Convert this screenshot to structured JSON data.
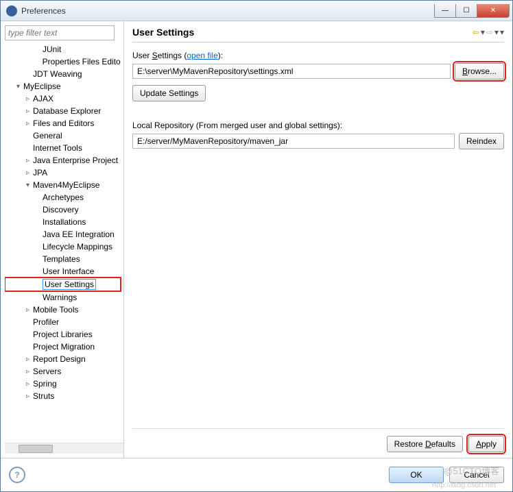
{
  "window": {
    "title": "Preferences"
  },
  "filter": {
    "placeholder": "type filter text"
  },
  "tree": {
    "items": [
      {
        "indent": 3,
        "label": "JUnit",
        "twisty": ""
      },
      {
        "indent": 3,
        "label": "Properties Files Editor",
        "twisty": ""
      },
      {
        "indent": 2,
        "label": "JDT Weaving",
        "twisty": ""
      },
      {
        "indent": 1,
        "label": "MyEclipse",
        "twisty": "▾"
      },
      {
        "indent": 2,
        "label": "AJAX",
        "twisty": "▹"
      },
      {
        "indent": 2,
        "label": "Database Explorer",
        "twisty": "▹"
      },
      {
        "indent": 2,
        "label": "Files and Editors",
        "twisty": "▹"
      },
      {
        "indent": 2,
        "label": "General",
        "twisty": ""
      },
      {
        "indent": 2,
        "label": "Internet Tools",
        "twisty": ""
      },
      {
        "indent": 2,
        "label": "Java Enterprise Project",
        "twisty": "▹"
      },
      {
        "indent": 2,
        "label": "JPA",
        "twisty": "▹"
      },
      {
        "indent": 2,
        "label": "Maven4MyEclipse",
        "twisty": "▾"
      },
      {
        "indent": 3,
        "label": "Archetypes",
        "twisty": ""
      },
      {
        "indent": 3,
        "label": "Discovery",
        "twisty": ""
      },
      {
        "indent": 3,
        "label": "Installations",
        "twisty": ""
      },
      {
        "indent": 3,
        "label": "Java EE Integration",
        "twisty": ""
      },
      {
        "indent": 3,
        "label": "Lifecycle Mappings",
        "twisty": ""
      },
      {
        "indent": 3,
        "label": "Templates",
        "twisty": ""
      },
      {
        "indent": 3,
        "label": "User Interface",
        "twisty": ""
      },
      {
        "indent": 3,
        "label": "User Settings",
        "twisty": "",
        "selected": true
      },
      {
        "indent": 3,
        "label": "Warnings",
        "twisty": ""
      },
      {
        "indent": 2,
        "label": "Mobile Tools",
        "twisty": "▹"
      },
      {
        "indent": 2,
        "label": "Profiler",
        "twisty": ""
      },
      {
        "indent": 2,
        "label": "Project Libraries",
        "twisty": ""
      },
      {
        "indent": 2,
        "label": "Project Migration",
        "twisty": ""
      },
      {
        "indent": 2,
        "label": "Report Design",
        "twisty": "▹"
      },
      {
        "indent": 2,
        "label": "Servers",
        "twisty": "▹"
      },
      {
        "indent": 2,
        "label": "Spring",
        "twisty": "▹"
      },
      {
        "indent": 2,
        "label": "Struts",
        "twisty": "▹"
      }
    ]
  },
  "page": {
    "heading": "User Settings",
    "userSettings": {
      "labelPrefix": "User ",
      "labelKey": "S",
      "labelSuffix": "ettings (",
      "openFile": "open file",
      "labelClose": "):",
      "value": "E:\\server\\MyMavenRepository\\settings.xml",
      "browse": "Browse...",
      "update": "Update Settings"
    },
    "localRepo": {
      "label": "Local Repository (From merged user and global settings):",
      "value": "E:/server/MyMavenRepository/maven_jar",
      "reindex": "Reindex"
    },
    "restore": "Restore Defaults",
    "restoreKey": "D",
    "apply": "Apply",
    "applyKey": "A"
  },
  "footer": {
    "ok": "OK",
    "cancel": "Cancel"
  },
  "watermark": "@51CTO博客",
  "watermark2": "http://blog.csdn.net"
}
